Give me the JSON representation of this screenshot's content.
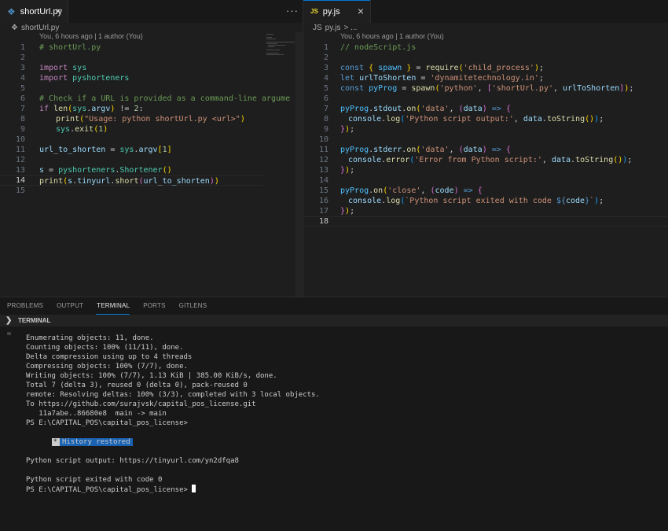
{
  "left_editor": {
    "tab": {
      "icon": "python-file-icon",
      "label": "shortUrl.py",
      "close": "×"
    },
    "more": "···",
    "breadcrumb": "shortUrl.py",
    "blame": "You, 6 hours ago | 1 author (You)",
    "line_numbers": [
      "1",
      "2",
      "3",
      "4",
      "5",
      "6",
      "7",
      "8",
      "9",
      "10",
      "11",
      "12",
      "13",
      "14",
      "15"
    ],
    "active_line": "14"
  },
  "right_editor": {
    "tab": {
      "icon": "js-file-icon",
      "icon_text": "JS",
      "label": "py.js",
      "close": "×"
    },
    "breadcrumb_file": "py.js",
    "breadcrumb_rest": "> ...",
    "blame": "You, 6 hours ago | 1 author (You)",
    "line_numbers": [
      "1",
      "2",
      "3",
      "4",
      "5",
      "6",
      "7",
      "8",
      "9",
      "10",
      "11",
      "12",
      "13",
      "14",
      "15",
      "16",
      "17",
      "18"
    ],
    "active_line": "18"
  },
  "panel": {
    "tabs": [
      "PROBLEMS",
      "OUTPUT",
      "TERMINAL",
      "PORTS",
      "GITLENS"
    ],
    "active_tab": "TERMINAL",
    "section_title": "TERMINAL",
    "lines": [
      "Enumerating objects: 11, done.",
      "Counting objects: 100% (11/11), done.",
      "Delta compression using up to 4 threads",
      "Compressing objects: 100% (7/7), done.",
      "Writing objects: 100% (7/7), 1.13 KiB | 385.00 KiB/s, done.",
      "Total 7 (delta 3), reused 0 (delta 0), pack-reused 0",
      "remote: Resolving deltas: 100% (3/3), completed with 3 local objects.",
      "To https://github.com/surajvsk/capital_pos_license.git",
      "   11a7abe..86680e8  main -> main",
      "PS E:\\CAPITAL_POS\\capital_pos_license>"
    ],
    "history_star": "*",
    "history_restored": "History restored",
    "output_line": "Python script output: https://tinyurl.com/yn2dfqa8",
    "exit_line": "Python script exited with code 0",
    "prompt": "PS E:\\CAPITAL_POS\\capital_pos_license>"
  },
  "colors": {
    "accent": "#0078d4",
    "history_bg": "#1a62b2"
  }
}
